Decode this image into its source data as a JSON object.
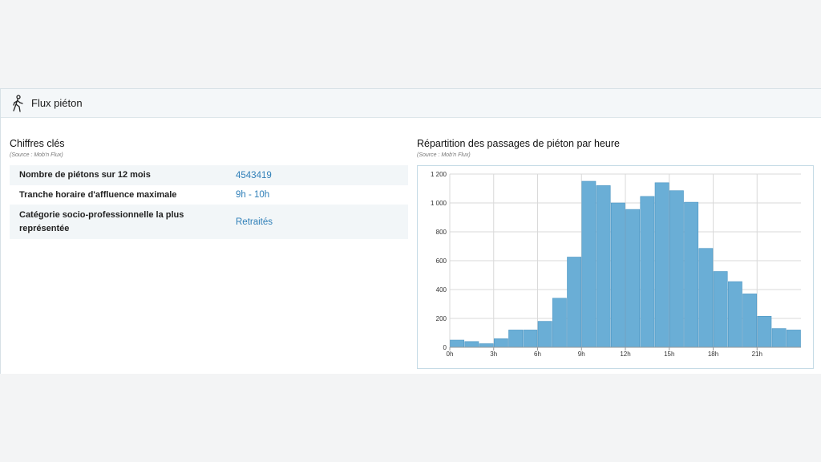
{
  "header": {
    "title": "Flux piéton",
    "icon": "pedestrian-walking-icon"
  },
  "key_figures": {
    "title": "Chiffres clés",
    "source": "(Source : Mob'n Flux)",
    "rows": [
      {
        "label": "Nombre de piétons sur 12 mois",
        "value": "4543419"
      },
      {
        "label": "Tranche horaire d'affluence maximale",
        "value": "9h - 10h"
      },
      {
        "label": "Catégorie socio-professionnelle la plus représentée",
        "value": "Retraités"
      }
    ]
  },
  "chart_section": {
    "title": "Répartition des passages de piéton par heure",
    "source": "(Source : Mob'n Flux)"
  },
  "colors": {
    "bar": "#6aaed6",
    "bar_edge": "#4e96c3",
    "value_link": "#2f7fb8"
  },
  "chart_data": {
    "type": "bar",
    "categories": [
      "0h",
      "1h",
      "2h",
      "3h",
      "4h",
      "5h",
      "6h",
      "7h",
      "8h",
      "9h",
      "10h",
      "11h",
      "12h",
      "13h",
      "14h",
      "15h",
      "16h",
      "17h",
      "18h",
      "19h",
      "20h",
      "21h",
      "22h",
      "23h"
    ],
    "values": [
      50,
      40,
      25,
      60,
      120,
      120,
      180,
      340,
      625,
      1150,
      1120,
      1000,
      955,
      1045,
      1140,
      1085,
      1005,
      685,
      525,
      455,
      370,
      215,
      130,
      120
    ],
    "xtick_labels": [
      "0h",
      "3h",
      "6h",
      "9h",
      "12h",
      "15h",
      "18h",
      "21h"
    ],
    "ytick_labels": [
      "0",
      "200",
      "400",
      "600",
      "800",
      "1 000",
      "1 200"
    ],
    "ylim": [
      0,
      1200
    ],
    "grid": true,
    "title": "",
    "xlabel": "",
    "ylabel": ""
  }
}
